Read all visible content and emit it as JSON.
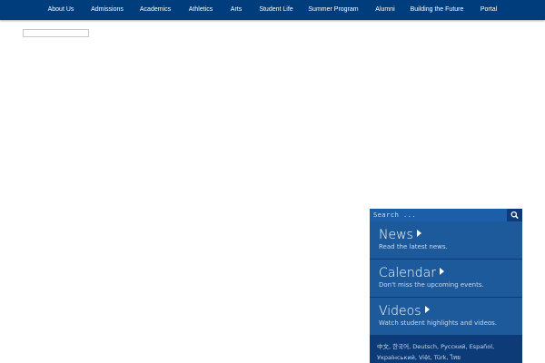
{
  "nav": {
    "items": [
      {
        "label": "About Us"
      },
      {
        "label": "Admissions"
      },
      {
        "label": "Academics"
      },
      {
        "label": "Athletics"
      },
      {
        "label": "Arts"
      },
      {
        "label": "Student Life"
      },
      {
        "label": "Summer Program"
      },
      {
        "label": "Alumni"
      },
      {
        "label": "Building the Future"
      },
      {
        "label": "Portal"
      }
    ]
  },
  "sidebar": {
    "search_placeholder": "Search ...",
    "tiles": [
      {
        "title": "News",
        "subtitle": "Read the latest news."
      },
      {
        "title": "Calendar",
        "subtitle": "Don't miss the upcoming events."
      },
      {
        "title": "Videos",
        "subtitle": "Watch student highlights and videos."
      }
    ],
    "languages": [
      "中文",
      "한국어",
      "Deutsch",
      "Русский",
      "Español",
      "Український",
      "Việt",
      "Türk",
      "ไทย"
    ]
  },
  "colors": {
    "nav_bg": "#003d7c",
    "tile_bg": "#1d5a9b",
    "search_bg": "#1d5ea8"
  }
}
